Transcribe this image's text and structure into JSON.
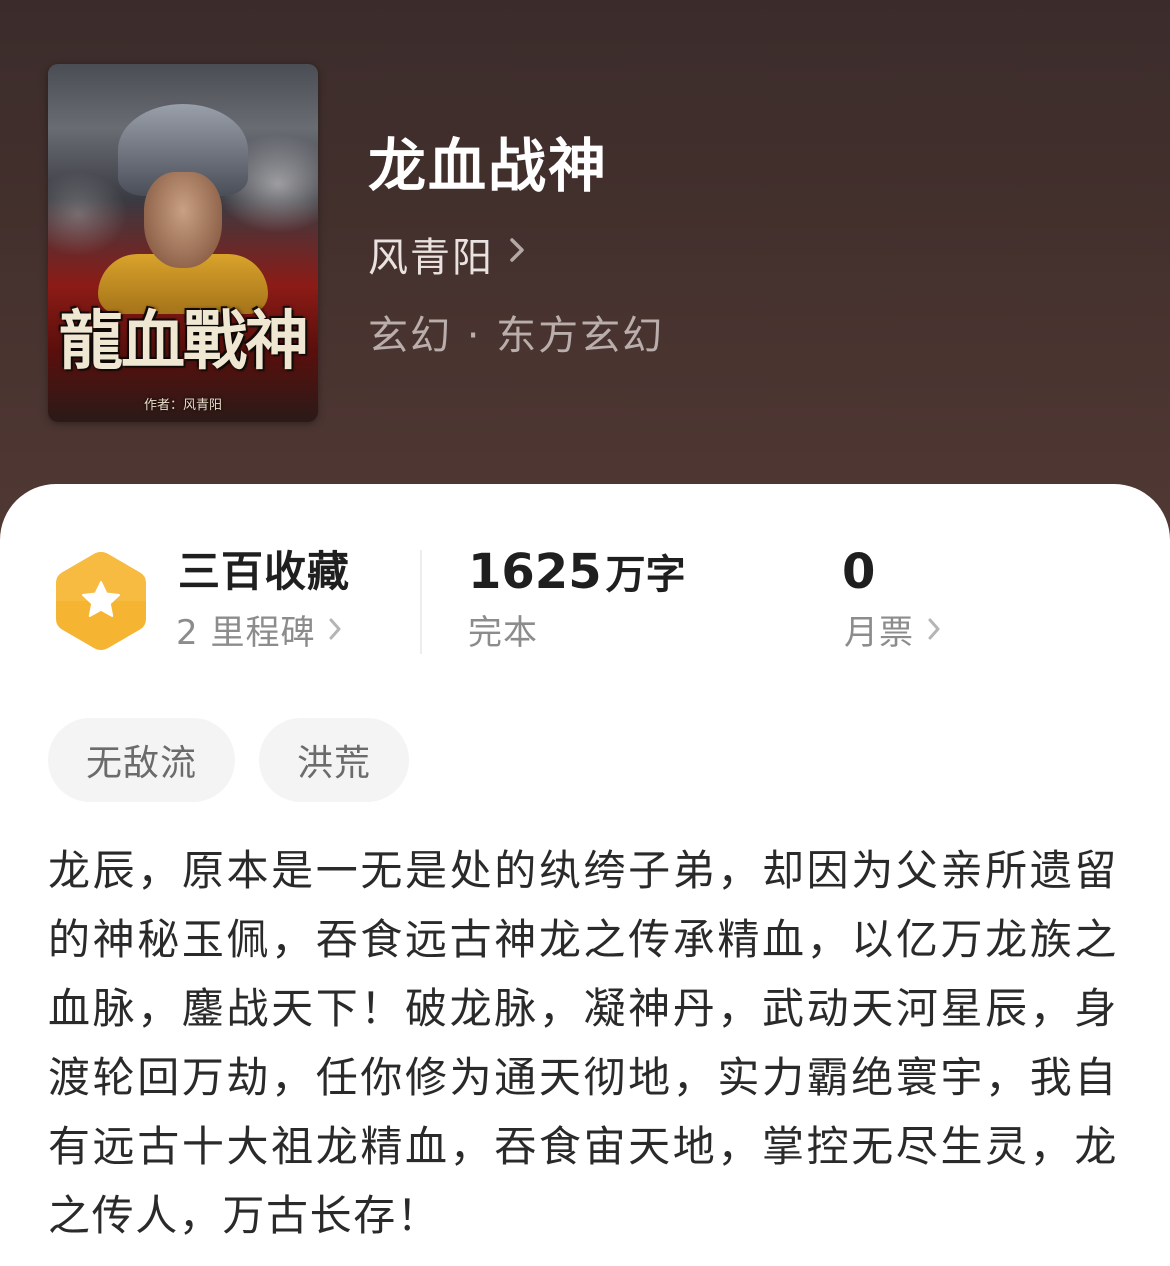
{
  "book": {
    "cover": {
      "title_art": "龍血戰神",
      "author_line": "作者：风青阳"
    },
    "title": "龙血战神",
    "author": "风青阳",
    "genre": "玄幻 · 东方玄幻"
  },
  "stats": {
    "favorites": {
      "title": "三百收藏",
      "subtitle": "2 里程碑",
      "icon": "star-badge-icon",
      "badge_color": "#f5b532"
    },
    "words": {
      "number": "1625",
      "unit": "万字",
      "status": "完本"
    },
    "monthly_ticket": {
      "value": "0",
      "label": "月票"
    }
  },
  "tags": [
    "无敌流",
    "洪荒"
  ],
  "description": "龙辰，原本是一无是处的纨绔子弟，却因为父亲所遗留的神秘玉佩，吞食远古神龙之传承精血，以亿万龙族之血脉，鏖战天下！破龙脉，凝神丹，武动天河星辰，身渡轮回万劫，任你修为通天彻地，实力霸绝寰宇，我自有远古十大祖龙精血，吞食宙天地，掌控无尽生灵，龙之传人，万古长存！",
  "colors": {
    "header_bg": "#43302d",
    "card_bg": "#ffffff",
    "accent": "#f5b532"
  }
}
